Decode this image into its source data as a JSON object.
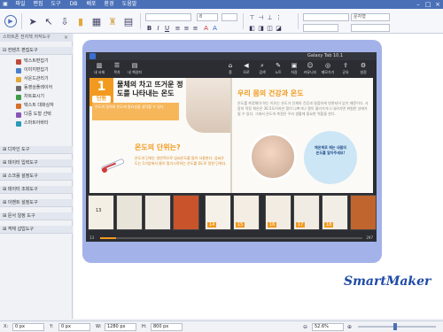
{
  "menu": [
    "파일",
    "편집",
    "도구",
    "DB",
    "배포",
    "환경",
    "도움말"
  ],
  "toolbar": {
    "font_size": "8",
    "style_select": "문자형",
    "zoom_hint": "▼"
  },
  "sidebar": {
    "panel_title": "스마트폰 전자책 저작도구",
    "groups": [
      {
        "label": "컨텐츠 편집도구",
        "expanded": true,
        "items": [
          {
            "label": "텍스트편집기",
            "color": "#c04a3a"
          },
          {
            "label": "이미지편집기",
            "color": "#4a80c9"
          },
          {
            "label": "사운드관리기",
            "color": "#e2a93a"
          },
          {
            "label": "동영상플레이어",
            "color": "#6b6b6b"
          },
          {
            "label": "차트표시기",
            "color": "#3f9a4a"
          },
          {
            "label": "텍스트 대화상자",
            "color": "#d86e2b"
          },
          {
            "label": "다중 도형 선택",
            "color": "#8a55b7"
          },
          {
            "label": "스마트아바타",
            "color": "#2a9ab8"
          }
        ]
      },
      {
        "label": "디자인 도구"
      },
      {
        "label": "데이터 입력도구"
      },
      {
        "label": "스크롤 설정도구"
      },
      {
        "label": "데이터 조회도구"
      },
      {
        "label": "이벤트 설정도구"
      },
      {
        "label": "문서 일정 도구"
      },
      {
        "label": "객체 삽입도구"
      }
    ]
  },
  "viewer": {
    "device_title": "Galaxy Tab 10.1",
    "left_buttons": [
      "내 서재",
      "목차",
      "내 책갈피"
    ],
    "right_buttons": [
      "홈",
      "뒤로",
      "검색",
      "노트",
      "저장",
      "커뮤니티",
      "메모가기",
      "공유",
      "설정"
    ],
    "lesson_number": "1",
    "lesson_word": "단원",
    "left_heading": "물체의 차고 뜨거운 정도를 나타내는 온도",
    "left_intro": "온도의 정의와 온도에 필요성을 생각할 수 있다.",
    "left_sub_heading": "온도의 단위는?",
    "left_body": "온도의 단위는 일반적으로 섭씨온도를 많이 사용한다. 섭씨온도는 1기압에서 물이 얼기시작하는 온도를 0도로 정한 단위다.",
    "right_heading": "우리 몸의 건강과 온도",
    "right_body": "온도를 측정해야 하는 이유는 온도가 인체의 건강과 밀접하게 연관되어 있기 때문이다. 사람의 적정 체온은 36.5도이지만 몸이 나쁘거나 열이 올라가거나 내려가면 위험한 상태가 될 수 있다. 그래서 온도의 측정은 우리 생활에 중요한 역할을 한다.",
    "badge_text": "체온계로 재는 내몸의 온도를 알아주세요!",
    "page_numbers": [
      "13",
      "",
      "",
      "",
      "14",
      "15",
      "16",
      "17",
      "18",
      ""
    ],
    "progress_start": "13",
    "progress_end": "297",
    "progress_fraction": 0.06
  },
  "statusbar": {
    "x_label": "X:",
    "x_value": "0 px",
    "y_label": "Y:",
    "y_value": "0 px",
    "w_label": "W:",
    "w_value": "1280 px",
    "h_label": "H:",
    "h_value": "800 px",
    "zoom_value": "52.6%"
  },
  "brand": {
    "logo_text": "SmartMaker",
    "accent": "#4a70b8",
    "orange": "#f29a1f"
  }
}
